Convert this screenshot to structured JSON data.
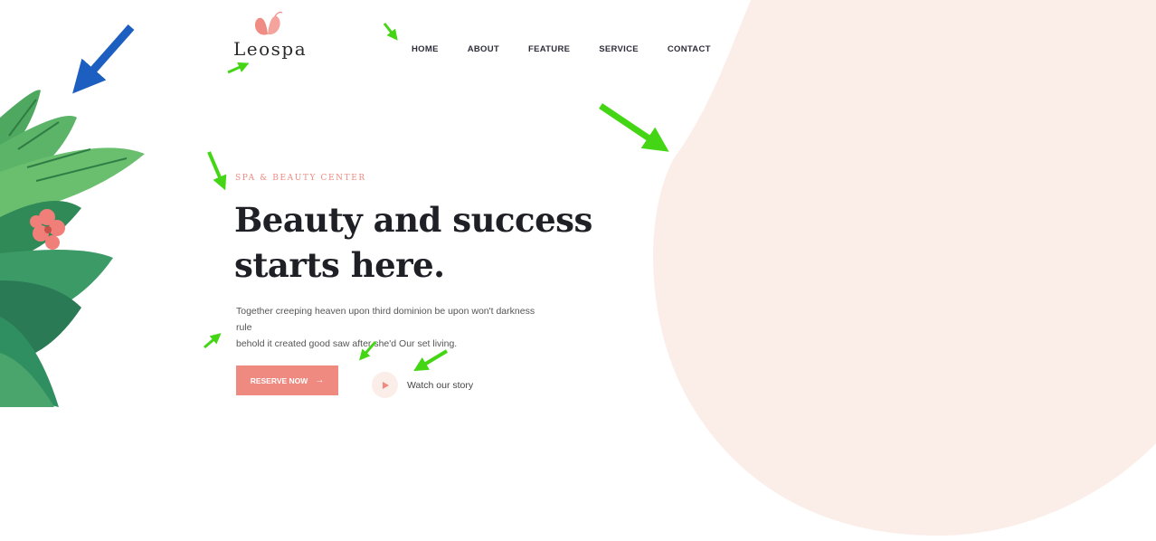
{
  "colors": {
    "accent": "#ee8a80",
    "blob": "#fbeee9",
    "heading": "#1f1f26",
    "annotation_green": "#44d615",
    "annotation_blue": "#1d5fc0"
  },
  "header": {
    "logo_text": "Leospa",
    "logo_icon": "butterfly-icon",
    "nav": [
      "HOME",
      "ABOUT",
      "FEATURE",
      "SERVICE",
      "CONTACT"
    ]
  },
  "hero": {
    "eyebrow": "SPA & BEAUTY CENTER",
    "headline_line1": "Beauty and success",
    "headline_line2": "starts here.",
    "description_line1": "Together creeping heaven upon third dominion be upon won't darkness rule",
    "description_line2": "behold it created good saw after she'd Our set living.",
    "cta_label": "RESERVE NOW",
    "cta_icon": "arrow-right-icon",
    "story_label": "Watch our story",
    "story_icon": "play-icon"
  },
  "decor": {
    "leaves_icon": "tropical-leaves-illustration",
    "annotation_arrows": "arrow-pointer-icon"
  }
}
